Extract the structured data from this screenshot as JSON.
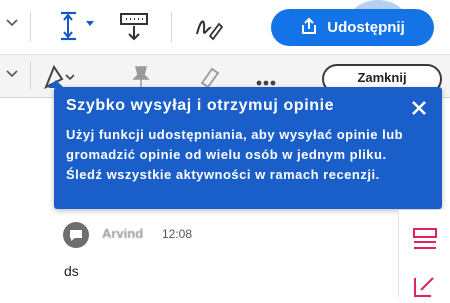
{
  "toolbar": {
    "share_label": "Udostępnij",
    "close_label": "Zamknij"
  },
  "coachmark": {
    "title": "Szybko wysyłaj i otrzymuj opinie",
    "body": "Użyj funkcji udostępniania, aby wysyłać opinie lub gromadzić opinie od wielu osób w jednym pliku. Śledź wszystkie aktywności w ramach recenzji."
  },
  "comment": {
    "author": "Arvind",
    "time": "12:08",
    "text": "ds"
  },
  "colors": {
    "accent": "#1473e6",
    "coachmark_bg": "#1a5fc9",
    "rail_icon": "#e0245e"
  },
  "icons": [
    "dropdown-caret-icon",
    "fit-page-icon",
    "download-icon",
    "sign-icon",
    "share-upload-icon",
    "shape-icon",
    "pin-icon",
    "highlighter-icon",
    "more-icon",
    "close-icon",
    "comment-bubble-icon",
    "organize-icon",
    "edit-icon"
  ]
}
